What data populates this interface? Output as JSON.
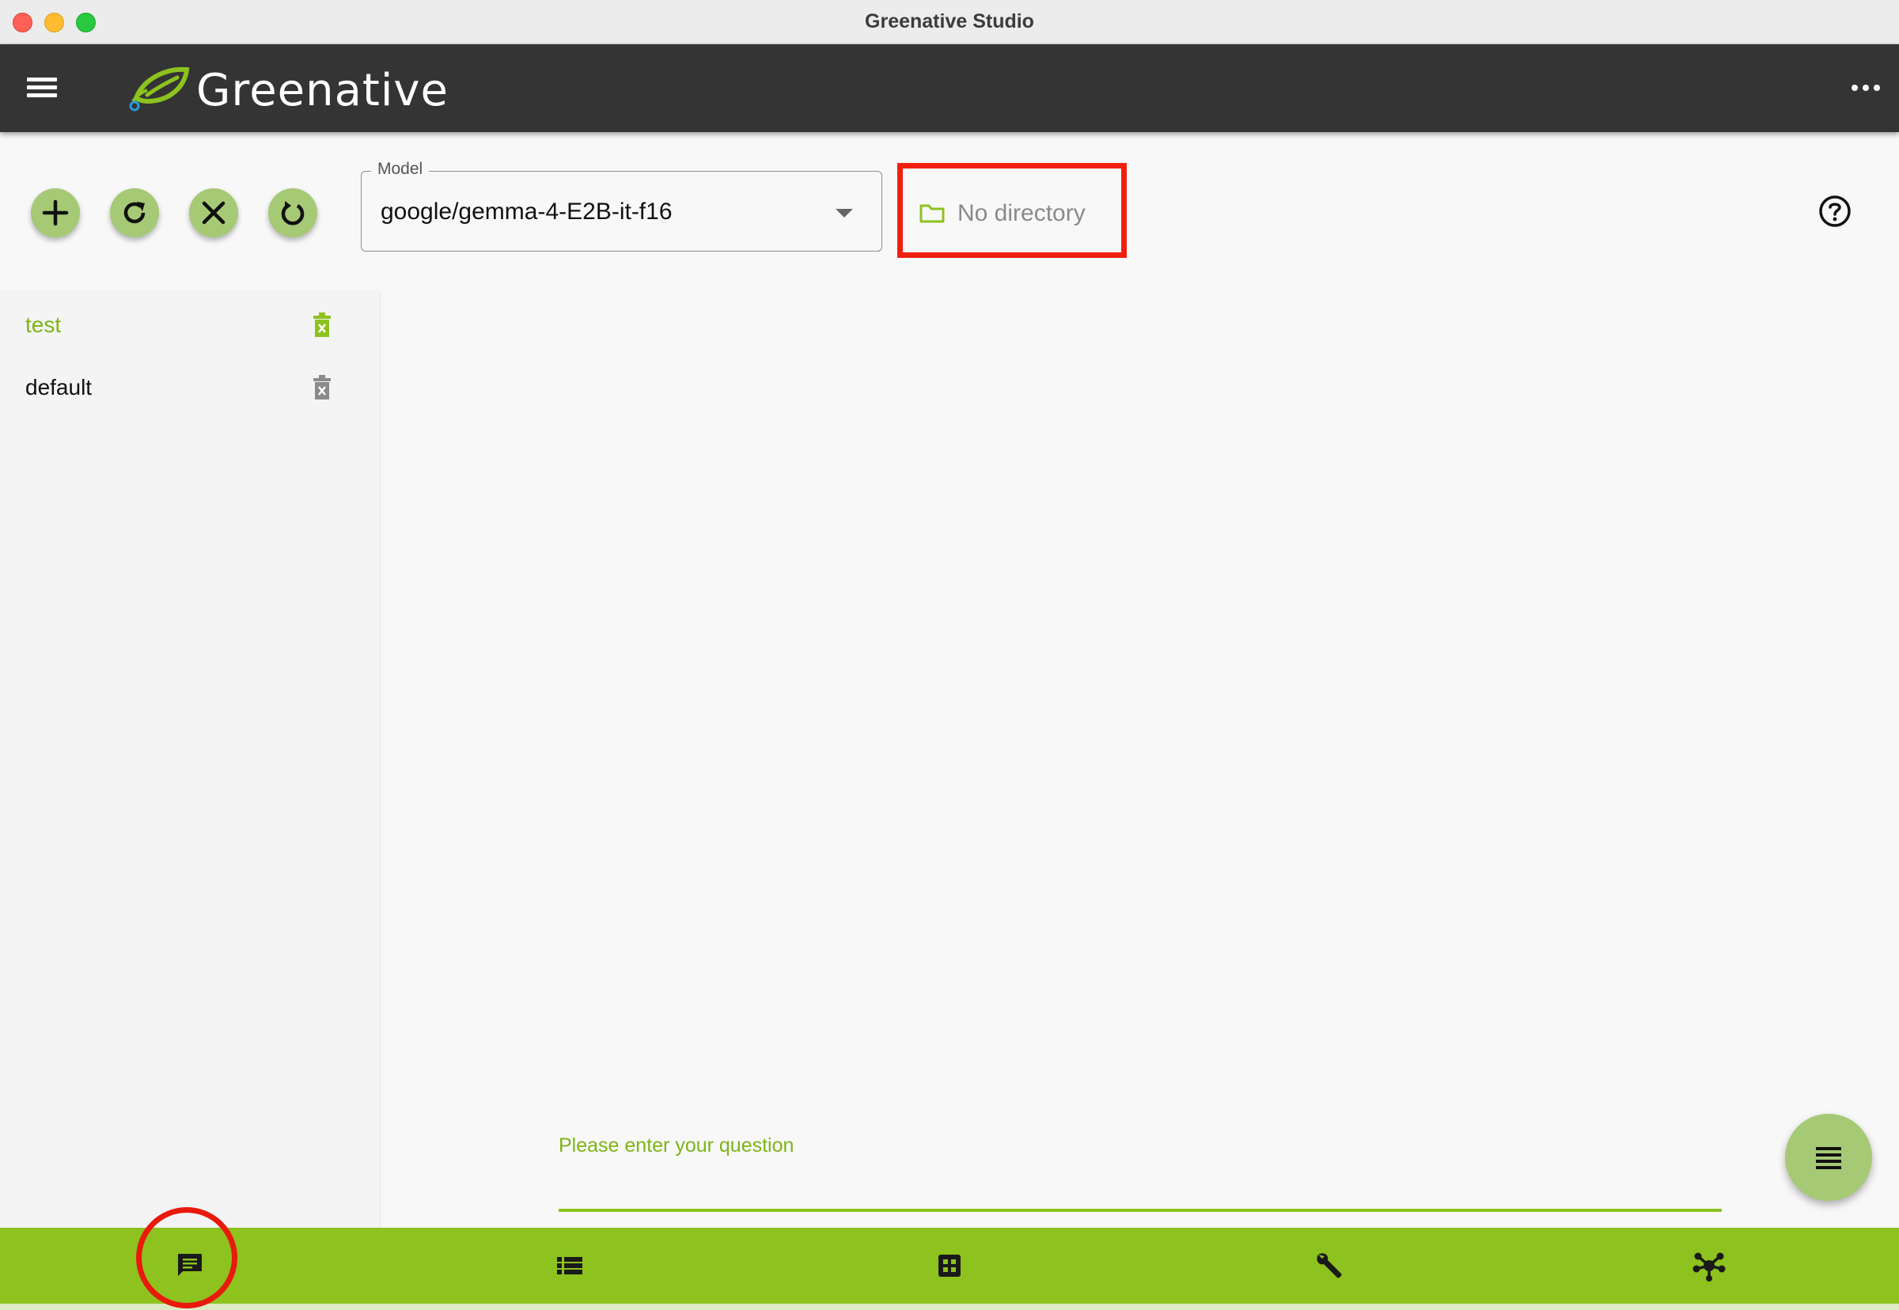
{
  "window": {
    "title": "Greenative Studio"
  },
  "appbar": {
    "brand": "Greenative",
    "menu_icon": "hamburger-menu-icon",
    "more_icon": "more-horizontal-icon"
  },
  "toolbar": {
    "buttons": [
      {
        "icon": "add-icon"
      },
      {
        "icon": "refresh-icon"
      },
      {
        "icon": "close-icon"
      },
      {
        "icon": "restart-icon"
      }
    ],
    "model": {
      "label": "Model",
      "value": "google/gemma-4-E2B-it-f16"
    },
    "directory": {
      "icon": "folder-icon",
      "label": "No directory"
    },
    "help_icon": "help-circle-icon"
  },
  "sidebar": {
    "items": [
      {
        "label": "test",
        "active": true
      },
      {
        "label": "default",
        "active": false
      }
    ]
  },
  "chat": {
    "input_placeholder": "Please enter your question"
  },
  "bottom_nav": {
    "items": [
      {
        "icon": "chat-icon",
        "active": true
      },
      {
        "icon": "list-icon",
        "active": false
      },
      {
        "icon": "grid-icon",
        "active": false
      },
      {
        "icon": "wrench-icon",
        "active": false
      },
      {
        "icon": "network-hub-icon",
        "active": false
      }
    ]
  },
  "colors": {
    "accent": "#8dc21f",
    "accent_text": "#7cb518",
    "appbar": "#343434",
    "fab": "#a6c975",
    "highlight": "#f01f0e"
  }
}
